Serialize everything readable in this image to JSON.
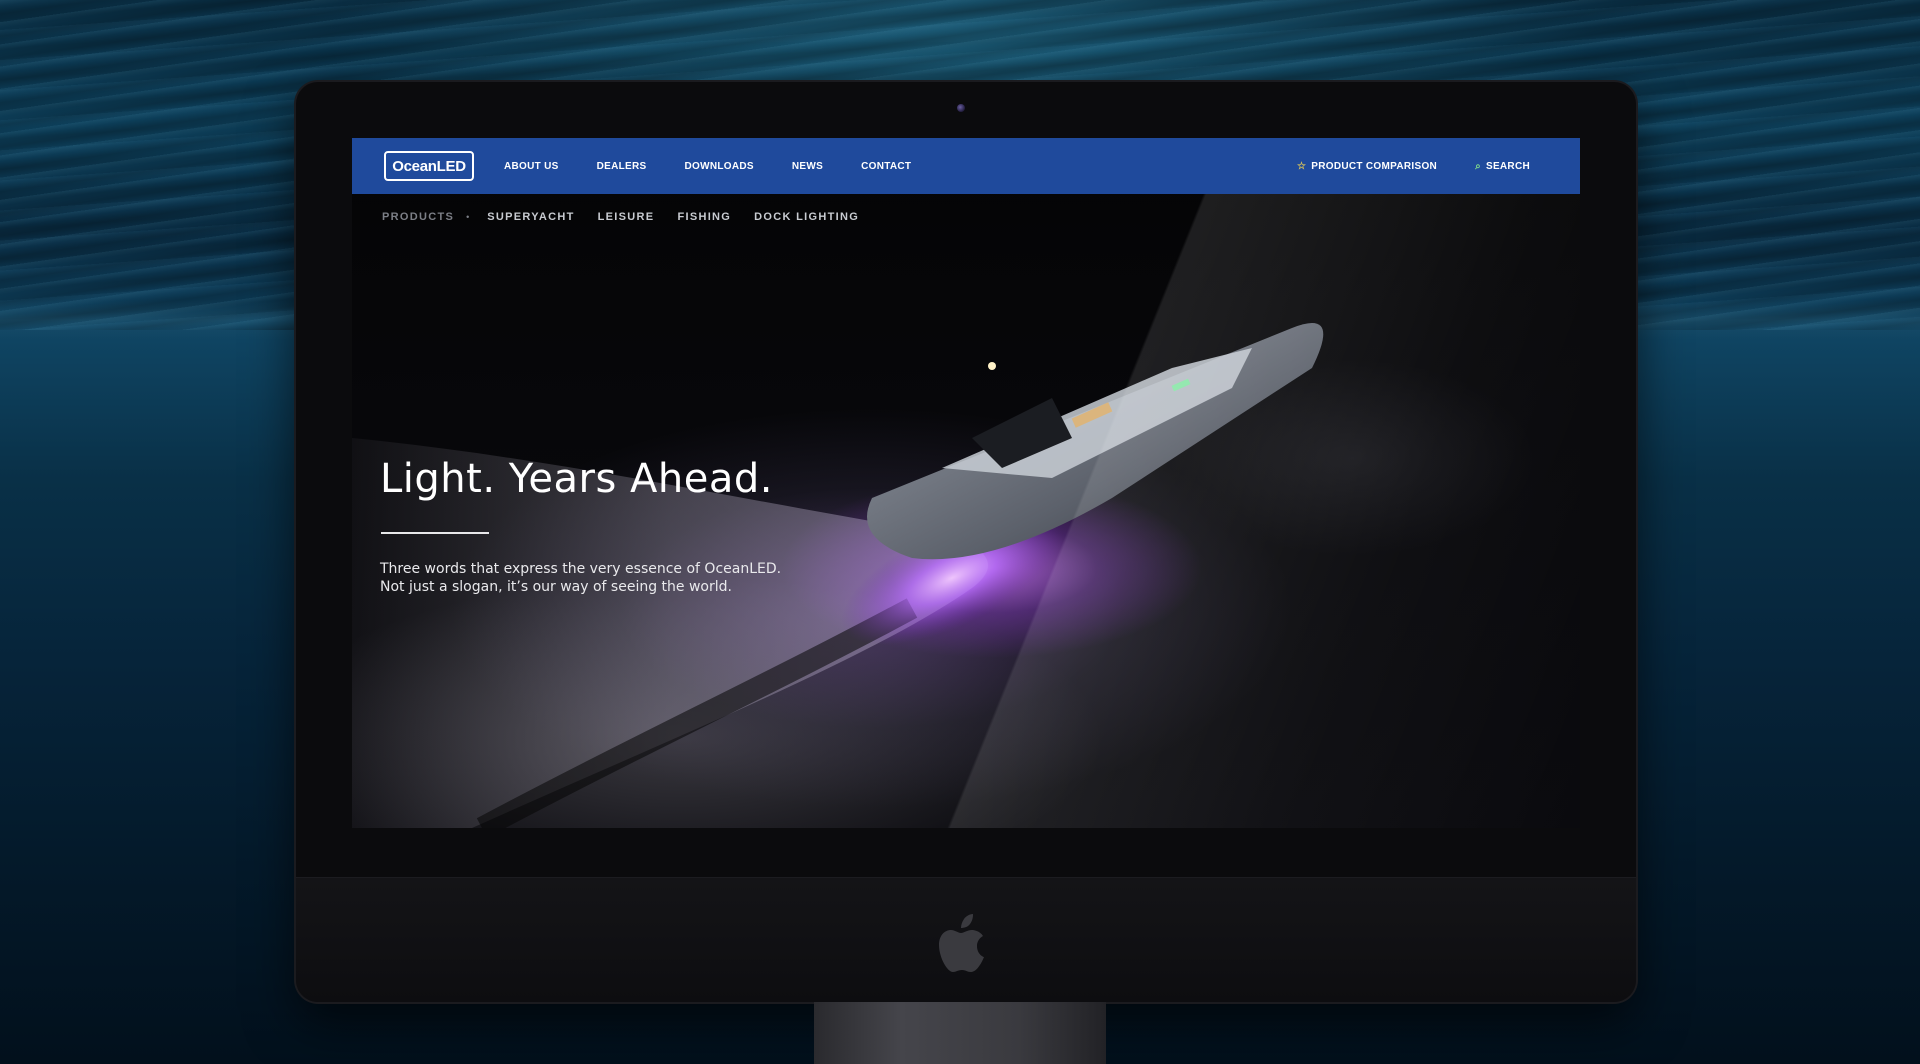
{
  "header": {
    "logo_text": "OceanLED",
    "nav": [
      "ABOUT US",
      "DEALERS",
      "DOWNLOADS",
      "NEWS",
      "CONTACT"
    ],
    "product_comparison": "PRODUCT COMPARISON",
    "search": "SEARCH",
    "icons": {
      "comparison": "star-icon",
      "search": "search-icon"
    }
  },
  "subnav": {
    "label": "PRODUCTS",
    "separator": "•",
    "items": [
      "SUPERYACHT",
      "LEISURE",
      "FISHING",
      "DOCK LIGHTING"
    ]
  },
  "hero": {
    "title": "Light. Years Ahead.",
    "line1": "Three words that express the very essence of OceanLED.",
    "line2": "Not just a slogan, it’s our way of seeing the world."
  },
  "colors": {
    "header_blue": "#1f4a9c",
    "accent_purple": "#b36cff",
    "text_white": "#ffffff"
  },
  "device": {
    "logo": "apple-logo"
  }
}
